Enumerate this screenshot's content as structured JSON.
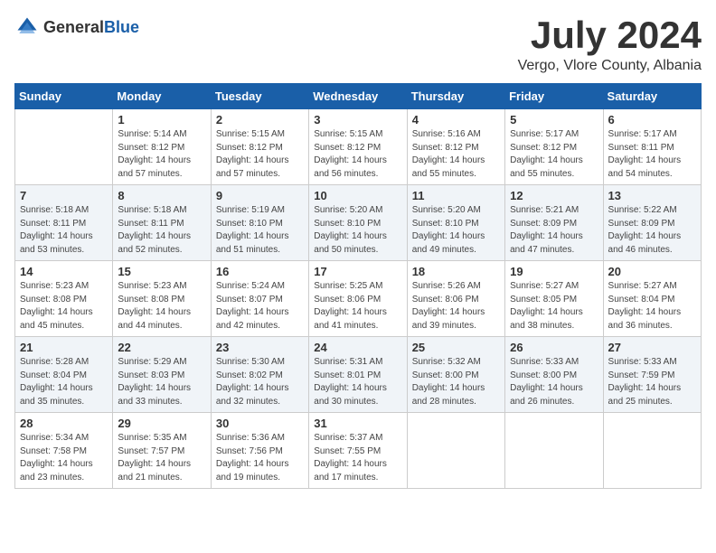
{
  "logo": {
    "general": "General",
    "blue": "Blue"
  },
  "title": "July 2024",
  "subtitle": "Vergo, Vlore County, Albania",
  "weekdays": [
    "Sunday",
    "Monday",
    "Tuesday",
    "Wednesday",
    "Thursday",
    "Friday",
    "Saturday"
  ],
  "weeks": [
    {
      "shaded": false,
      "days": [
        {
          "num": "",
          "sunrise": "",
          "sunset": "",
          "daylight": ""
        },
        {
          "num": "1",
          "sunrise": "Sunrise: 5:14 AM",
          "sunset": "Sunset: 8:12 PM",
          "daylight": "Daylight: 14 hours and 57 minutes."
        },
        {
          "num": "2",
          "sunrise": "Sunrise: 5:15 AM",
          "sunset": "Sunset: 8:12 PM",
          "daylight": "Daylight: 14 hours and 57 minutes."
        },
        {
          "num": "3",
          "sunrise": "Sunrise: 5:15 AM",
          "sunset": "Sunset: 8:12 PM",
          "daylight": "Daylight: 14 hours and 56 minutes."
        },
        {
          "num": "4",
          "sunrise": "Sunrise: 5:16 AM",
          "sunset": "Sunset: 8:12 PM",
          "daylight": "Daylight: 14 hours and 55 minutes."
        },
        {
          "num": "5",
          "sunrise": "Sunrise: 5:17 AM",
          "sunset": "Sunset: 8:12 PM",
          "daylight": "Daylight: 14 hours and 55 minutes."
        },
        {
          "num": "6",
          "sunrise": "Sunrise: 5:17 AM",
          "sunset": "Sunset: 8:11 PM",
          "daylight": "Daylight: 14 hours and 54 minutes."
        }
      ]
    },
    {
      "shaded": true,
      "days": [
        {
          "num": "7",
          "sunrise": "Sunrise: 5:18 AM",
          "sunset": "Sunset: 8:11 PM",
          "daylight": "Daylight: 14 hours and 53 minutes."
        },
        {
          "num": "8",
          "sunrise": "Sunrise: 5:18 AM",
          "sunset": "Sunset: 8:11 PM",
          "daylight": "Daylight: 14 hours and 52 minutes."
        },
        {
          "num": "9",
          "sunrise": "Sunrise: 5:19 AM",
          "sunset": "Sunset: 8:10 PM",
          "daylight": "Daylight: 14 hours and 51 minutes."
        },
        {
          "num": "10",
          "sunrise": "Sunrise: 5:20 AM",
          "sunset": "Sunset: 8:10 PM",
          "daylight": "Daylight: 14 hours and 50 minutes."
        },
        {
          "num": "11",
          "sunrise": "Sunrise: 5:20 AM",
          "sunset": "Sunset: 8:10 PM",
          "daylight": "Daylight: 14 hours and 49 minutes."
        },
        {
          "num": "12",
          "sunrise": "Sunrise: 5:21 AM",
          "sunset": "Sunset: 8:09 PM",
          "daylight": "Daylight: 14 hours and 47 minutes."
        },
        {
          "num": "13",
          "sunrise": "Sunrise: 5:22 AM",
          "sunset": "Sunset: 8:09 PM",
          "daylight": "Daylight: 14 hours and 46 minutes."
        }
      ]
    },
    {
      "shaded": false,
      "days": [
        {
          "num": "14",
          "sunrise": "Sunrise: 5:23 AM",
          "sunset": "Sunset: 8:08 PM",
          "daylight": "Daylight: 14 hours and 45 minutes."
        },
        {
          "num": "15",
          "sunrise": "Sunrise: 5:23 AM",
          "sunset": "Sunset: 8:08 PM",
          "daylight": "Daylight: 14 hours and 44 minutes."
        },
        {
          "num": "16",
          "sunrise": "Sunrise: 5:24 AM",
          "sunset": "Sunset: 8:07 PM",
          "daylight": "Daylight: 14 hours and 42 minutes."
        },
        {
          "num": "17",
          "sunrise": "Sunrise: 5:25 AM",
          "sunset": "Sunset: 8:06 PM",
          "daylight": "Daylight: 14 hours and 41 minutes."
        },
        {
          "num": "18",
          "sunrise": "Sunrise: 5:26 AM",
          "sunset": "Sunset: 8:06 PM",
          "daylight": "Daylight: 14 hours and 39 minutes."
        },
        {
          "num": "19",
          "sunrise": "Sunrise: 5:27 AM",
          "sunset": "Sunset: 8:05 PM",
          "daylight": "Daylight: 14 hours and 38 minutes."
        },
        {
          "num": "20",
          "sunrise": "Sunrise: 5:27 AM",
          "sunset": "Sunset: 8:04 PM",
          "daylight": "Daylight: 14 hours and 36 minutes."
        }
      ]
    },
    {
      "shaded": true,
      "days": [
        {
          "num": "21",
          "sunrise": "Sunrise: 5:28 AM",
          "sunset": "Sunset: 8:04 PM",
          "daylight": "Daylight: 14 hours and 35 minutes."
        },
        {
          "num": "22",
          "sunrise": "Sunrise: 5:29 AM",
          "sunset": "Sunset: 8:03 PM",
          "daylight": "Daylight: 14 hours and 33 minutes."
        },
        {
          "num": "23",
          "sunrise": "Sunrise: 5:30 AM",
          "sunset": "Sunset: 8:02 PM",
          "daylight": "Daylight: 14 hours and 32 minutes."
        },
        {
          "num": "24",
          "sunrise": "Sunrise: 5:31 AM",
          "sunset": "Sunset: 8:01 PM",
          "daylight": "Daylight: 14 hours and 30 minutes."
        },
        {
          "num": "25",
          "sunrise": "Sunrise: 5:32 AM",
          "sunset": "Sunset: 8:00 PM",
          "daylight": "Daylight: 14 hours and 28 minutes."
        },
        {
          "num": "26",
          "sunrise": "Sunrise: 5:33 AM",
          "sunset": "Sunset: 8:00 PM",
          "daylight": "Daylight: 14 hours and 26 minutes."
        },
        {
          "num": "27",
          "sunrise": "Sunrise: 5:33 AM",
          "sunset": "Sunset: 7:59 PM",
          "daylight": "Daylight: 14 hours and 25 minutes."
        }
      ]
    },
    {
      "shaded": false,
      "days": [
        {
          "num": "28",
          "sunrise": "Sunrise: 5:34 AM",
          "sunset": "Sunset: 7:58 PM",
          "daylight": "Daylight: 14 hours and 23 minutes."
        },
        {
          "num": "29",
          "sunrise": "Sunrise: 5:35 AM",
          "sunset": "Sunset: 7:57 PM",
          "daylight": "Daylight: 14 hours and 21 minutes."
        },
        {
          "num": "30",
          "sunrise": "Sunrise: 5:36 AM",
          "sunset": "Sunset: 7:56 PM",
          "daylight": "Daylight: 14 hours and 19 minutes."
        },
        {
          "num": "31",
          "sunrise": "Sunrise: 5:37 AM",
          "sunset": "Sunset: 7:55 PM",
          "daylight": "Daylight: 14 hours and 17 minutes."
        },
        {
          "num": "",
          "sunrise": "",
          "sunset": "",
          "daylight": ""
        },
        {
          "num": "",
          "sunrise": "",
          "sunset": "",
          "daylight": ""
        },
        {
          "num": "",
          "sunrise": "",
          "sunset": "",
          "daylight": ""
        }
      ]
    }
  ]
}
